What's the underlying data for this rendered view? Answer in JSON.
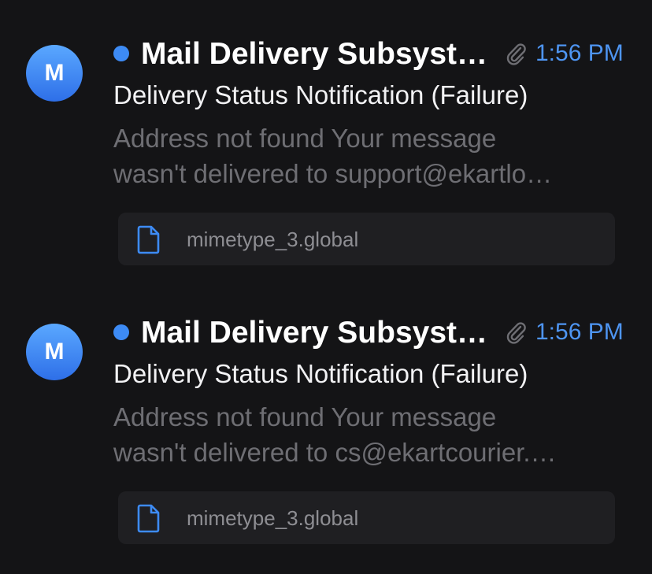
{
  "messages": [
    {
      "avatar_letter": "M",
      "sender": "Mail Delivery Subsyst…",
      "time": "1:56 PM",
      "subject": "Delivery Status Notification (Failure)",
      "preview_line1": "Address not found Your message",
      "preview_line2": "wasn't delivered to support@ekartlo…",
      "attachment_name": "mimetype_3.global",
      "unread": true,
      "has_attachment_icon": "paperclip-icon"
    },
    {
      "avatar_letter": "M",
      "sender": "Mail Delivery Subsyst…",
      "time": "1:56 PM",
      "subject": "Delivery Status Notification (Failure)",
      "preview_line1": "Address not found Your message",
      "preview_line2": "wasn't delivered to cs@ekartcourier.…",
      "attachment_name": "mimetype_3.global",
      "unread": true,
      "has_attachment_icon": "paperclip-icon"
    }
  ],
  "colors": {
    "background": "#141416",
    "accent": "#3d8bf5",
    "time": "#4e95f2",
    "preview": "#6e6e73",
    "attachment_bg": "#1f1f22"
  }
}
